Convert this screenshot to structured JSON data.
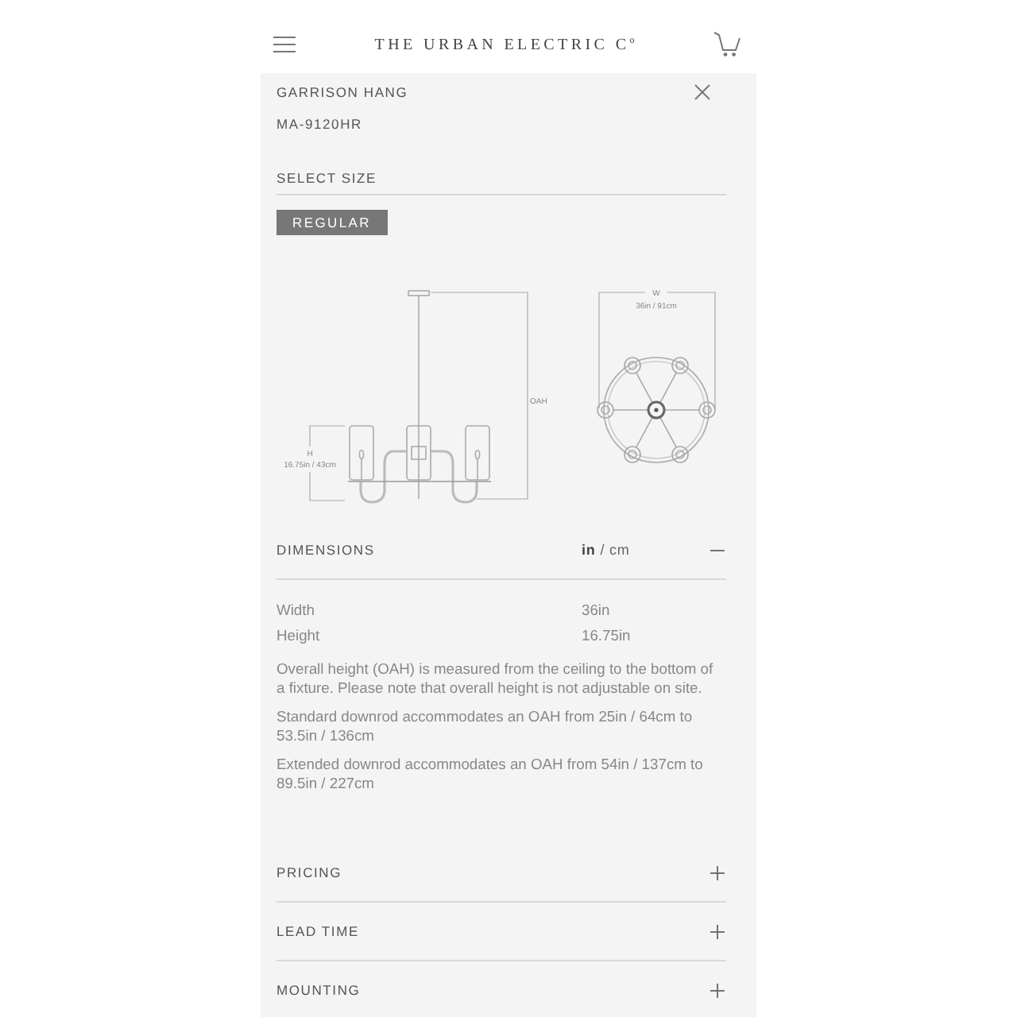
{
  "header": {
    "logo": "THE URBAN ELECTRIC C$^{o}$"
  },
  "product": {
    "name": "GARRISON HANG",
    "sku": "MA-9120HR"
  },
  "size_select": {
    "label": "SELECT SIZE",
    "options": [
      {
        "label": "REGULAR",
        "selected": true
      }
    ]
  },
  "diagram": {
    "side_view": {
      "height_symbol": "H",
      "height_value": "16.75in / 43cm",
      "overall_height_symbol": "OAH"
    },
    "top_view": {
      "width_symbol": "W",
      "width_value": "36in / 91cm"
    }
  },
  "sections": [
    {
      "title": "DIMENSIONS",
      "expanded": true,
      "unit_toggle": "**in** / cm",
      "specs": [
        {
          "label": "Width",
          "value": "36in"
        },
        {
          "label": "Height",
          "value": "16.75in"
        }
      ],
      "notes": [
        "Overall height (OAH) is measured from the ceiling to the bottom of a fixture. Please note that overall height is not adjustable on site.",
        "Standard downrod accommodates an OAH from 25in / 64cm to 53.5in / 136cm",
        "Extended downrod accommodates an OAH from 54in / 137cm to 89.5in / 227cm"
      ]
    },
    {
      "title": "PRICING",
      "expanded": false
    },
    {
      "title": "LEAD TIME",
      "expanded": false
    },
    {
      "title": "MOUNTING",
      "expanded": false
    }
  ]
}
